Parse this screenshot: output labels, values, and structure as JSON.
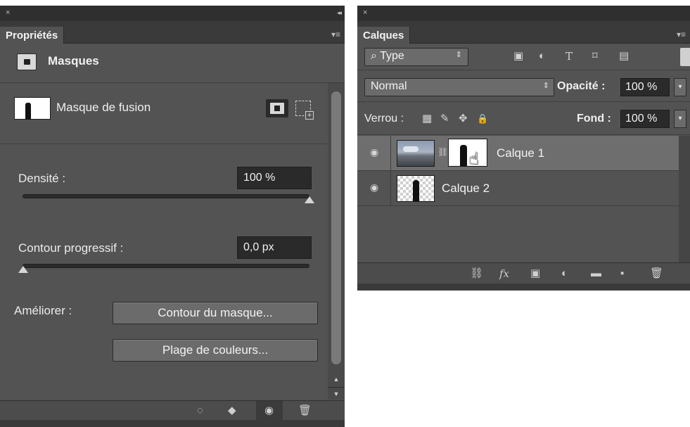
{
  "properties": {
    "tab": "Propriétés",
    "header_title": "Masques",
    "mask_label": "Masque de fusion",
    "density_label": "Densité :",
    "density_value": "100 %",
    "density_level": 1.0,
    "feather_label": "Contour progressif :",
    "feather_value": "0,0 px",
    "feather_level": 0.0,
    "refine_label": "Améliorer :",
    "mask_edge_button": "Contour du masque...",
    "color_range_button": "Plage de couleurs..."
  },
  "layers": {
    "tab": "Calques",
    "filter_type": "Type",
    "filter_type_prefix": "⌕",
    "blend_mode": "Normal",
    "opacity_label": "Opacité :",
    "opacity_value": "100 %",
    "lock_label": "Verrou :",
    "fill_label": "Fond :",
    "fill_value": "100 %",
    "items": [
      {
        "name": "Calque 1",
        "selected": true
      },
      {
        "name": "Calque 2",
        "selected": false
      }
    ]
  },
  "icons": {
    "close": "×",
    "collapse": "◂◂",
    "panel_menu": "▾≡",
    "select_arrows": "⇕",
    "dropdown": "▾",
    "eye": "◉",
    "link": "⛓",
    "trash": "🗑",
    "selection": "◌",
    "apply": "◆",
    "filter_image": "▣",
    "filter_adjust": "◐",
    "filter_text": "T",
    "filter_shape": "⌑",
    "filter_smart": "▤",
    "lock_pixels": "▦",
    "lock_paint": "✎",
    "lock_move": "✥",
    "lock_all": "🔒",
    "fx": "fx",
    "add_mask": "▣",
    "adjust": "◐",
    "folder": "▬",
    "new_layer": "▪",
    "hand_cursor": "☝"
  }
}
